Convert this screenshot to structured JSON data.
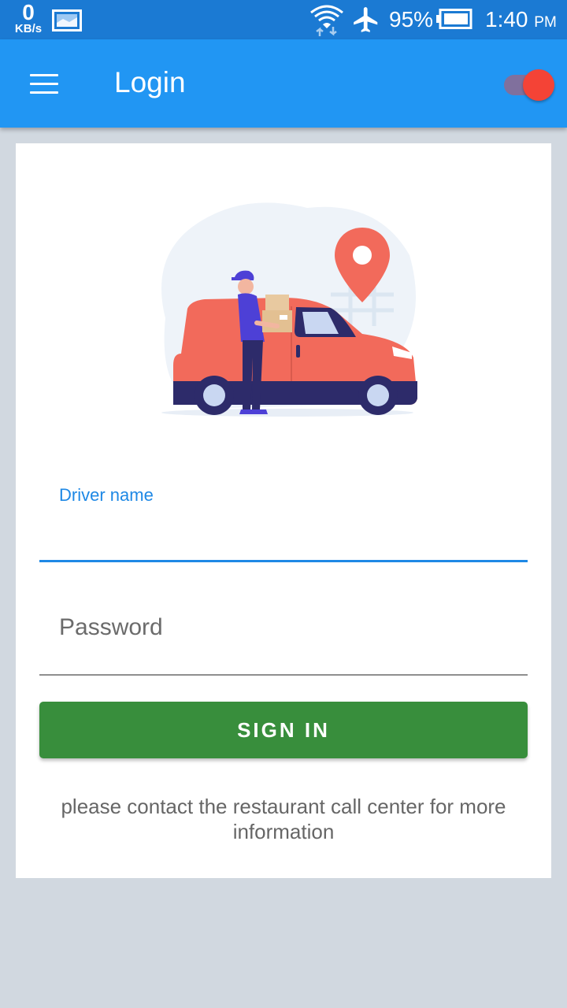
{
  "status_bar": {
    "net_speed_value": "0",
    "net_speed_unit": "KB/s",
    "battery_percent": "95%",
    "time": "1:40",
    "ampm": "PM",
    "icons": [
      "gallery-icon",
      "wifi-icon",
      "airplane-mode-icon",
      "battery-icon"
    ]
  },
  "app_bar": {
    "title": "Login",
    "color": "#2196f3",
    "toggle_on": true,
    "toggle_color": "#f44336"
  },
  "form": {
    "driver_name_label": "Driver name",
    "driver_name_value": "",
    "password_placeholder": "Password",
    "password_value": "",
    "sign_in_label": "SIGN IN",
    "sign_in_color": "#388e3c",
    "info_text": "please contact the restaurant call center for more information"
  },
  "illustration": {
    "icon": "delivery-van-illustration",
    "accent": "#f26a5b"
  }
}
